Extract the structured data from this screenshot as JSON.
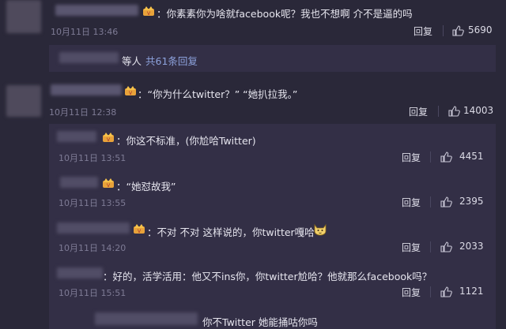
{
  "comments": [
    {
      "text": "：你素素你为啥就facebook呢？我也不想啊 介不是逼的吗",
      "time": "10月11日 13:46",
      "reply_label": "回复",
      "likes": "5690"
    }
  ],
  "more_replies": {
    "prefix": "等人",
    "count_text": "共61条回复"
  },
  "comment2": {
    "text": "：“你为什么twitter？” “她扒拉我。”",
    "time": "10月11日 12:38",
    "reply_label": "回复",
    "likes": "14003"
  },
  "replies": [
    {
      "text": "：你这不标准，(你尬哈Twitter)",
      "time": "10月11日 13:51",
      "reply_label": "回复",
      "likes": "4451"
    },
    {
      "text": "：“她怼故我”",
      "time": "10月11日 13:55",
      "reply_label": "回复",
      "likes": "2395"
    },
    {
      "text": "：不对 不对 这样说的，你twitter嘎哈",
      "time": "10月11日 14:20",
      "reply_label": "回复",
      "likes": "2033"
    },
    {
      "text": "：好的，活学活用：他又不ins你，你twitter尬哈？他就那么facebook吗？",
      "time": "10月11日 15:51",
      "reply_label": "回复",
      "likes": "1121"
    },
    {
      "text": "你不Twitter 她能捅咕你吗"
    }
  ],
  "colors": {
    "background": "#2a2839",
    "panel": "#332f46",
    "link": "#8da2dc",
    "badge": "#e8a23a"
  },
  "icons": {
    "vip_badge": "crown-badge-icon",
    "like": "thumb-up-icon",
    "emoji": "cat-face-emoji-icon"
  }
}
